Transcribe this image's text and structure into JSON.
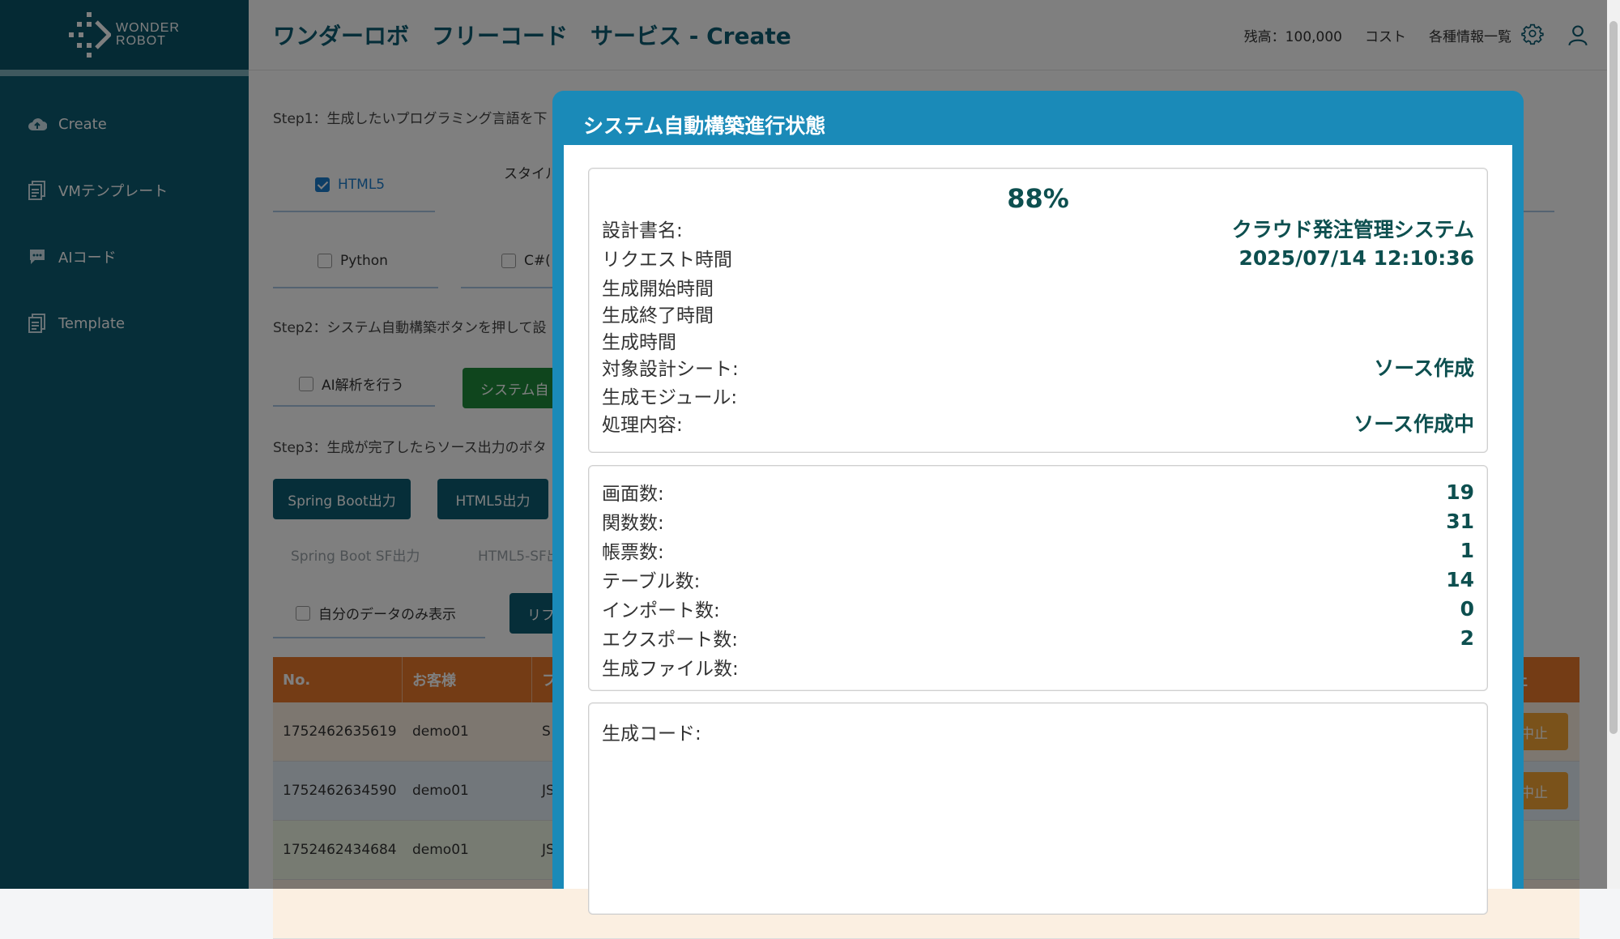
{
  "logo": {
    "line1": "WONDER",
    "line2": "ROBOT"
  },
  "sidebar": {
    "items": [
      {
        "label": "Create",
        "icon": "cloud-upload-icon"
      },
      {
        "label": "VMテンプレート",
        "icon": "document-icon"
      },
      {
        "label": "AIコード",
        "icon": "chat-icon"
      },
      {
        "label": "Template",
        "icon": "document-icon"
      }
    ]
  },
  "header": {
    "title": "ワンダーロボ　フリーコード　サービス - Create",
    "balance": "残高：100,000",
    "cost": "コスト",
    "info_list": "各種情報一覧"
  },
  "main": {
    "step1": "Step1：生成したいプログラミング言語を下",
    "style_label": "スタイル",
    "lang_options": [
      {
        "label": "HTML5",
        "checked": true
      },
      {
        "label": "Python",
        "checked": false
      },
      {
        "label": "C#(",
        "checked": false
      }
    ],
    "step2": "Step2：システム自動構築ボタンを押して設",
    "ai_analysis": "AI解析を行う",
    "build_button": "システム自",
    "step3": "Step3：生成が完了したらソース出力のボタ",
    "spring_boot_button": "Spring Boot出力",
    "html5_button": "HTML5出力",
    "spring_boot_sf": "Spring Boot SF出力",
    "html5_sf": "HTML5-SF出",
    "my_data_only": "自分のデータのみ表示",
    "refresh_button": "リフ",
    "table": {
      "headers": [
        "No.",
        "お客様",
        "フ",
        "理中止"
      ],
      "rows": [
        {
          "no": "1752462635619",
          "customer": "demo01",
          "col3": "S",
          "action": "中止"
        },
        {
          "no": "1752462634590",
          "customer": "demo01",
          "col3": "JS",
          "action": "中止"
        },
        {
          "no": "1752462434684",
          "customer": "demo01",
          "col3": "JS",
          "action": ""
        }
      ]
    }
  },
  "modal": {
    "title": "システム自動構築進行状態",
    "percent": "88%",
    "info": [
      {
        "label": "設計書名:",
        "value": "クラウド発注管理システム"
      },
      {
        "label": "リクエスト時間",
        "value": "2025/07/14 12:10:36"
      },
      {
        "label": "生成開始時間",
        "value": ""
      },
      {
        "label": "生成終了時間",
        "value": ""
      },
      {
        "label": "生成時間",
        "value": ""
      },
      {
        "label": "対象設計シート:",
        "value": "ソース作成"
      },
      {
        "label": "生成モジュール:",
        "value": ""
      },
      {
        "label": "処理内容:",
        "value": "ソース作成中"
      }
    ],
    "counts": [
      {
        "label": "画面数:",
        "value": "19"
      },
      {
        "label": "関数数:",
        "value": "31"
      },
      {
        "label": "帳票数:",
        "value": "1"
      },
      {
        "label": "テーブル数:",
        "value": "14"
      },
      {
        "label": "インポート数:",
        "value": "0"
      },
      {
        "label": "エクスポート数:",
        "value": "2"
      },
      {
        "label": "生成ファイル数:",
        "value": ""
      }
    ],
    "code_label": "生成コード:"
  },
  "colors": {
    "primary": "#0d5c72",
    "modal_header": "#1a8ab8",
    "table_header": "#e8782a",
    "build": "#1e8b3a",
    "stop": "#f4a534"
  }
}
